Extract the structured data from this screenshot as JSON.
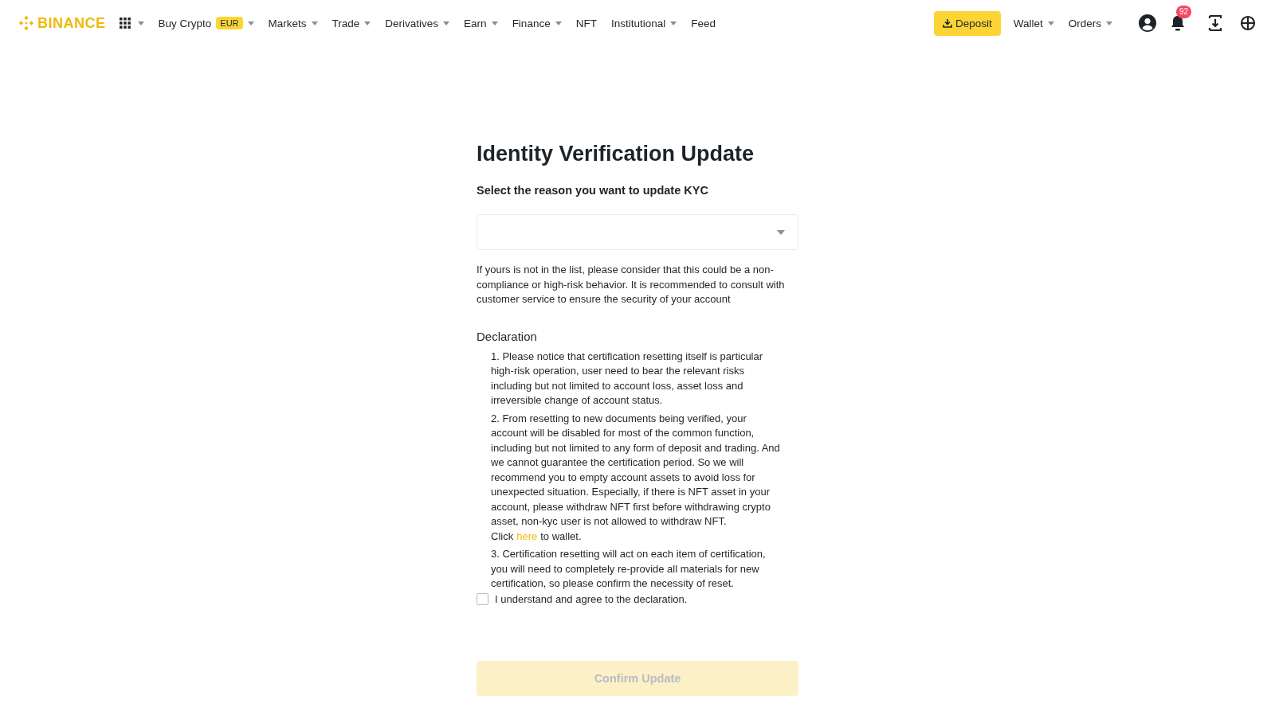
{
  "nav": {
    "logo": "BINANCE",
    "items": [
      {
        "label": "Buy Crypto",
        "badge": "EUR",
        "dropdown": true
      },
      {
        "label": "Markets",
        "dropdown": true
      },
      {
        "label": "Trade",
        "dropdown": true
      },
      {
        "label": "Derivatives",
        "dropdown": true
      },
      {
        "label": "Earn",
        "dropdown": true
      },
      {
        "label": "Finance",
        "dropdown": true
      },
      {
        "label": "NFT",
        "dropdown": false
      },
      {
        "label": "Institutional",
        "dropdown": true
      },
      {
        "label": "Feed",
        "dropdown": false
      }
    ],
    "deposit": "Deposit",
    "right_items": [
      {
        "label": "Wallet",
        "dropdown": true
      },
      {
        "label": "Orders",
        "dropdown": true
      }
    ],
    "notification_count": "92"
  },
  "page": {
    "title": "Identity Verification Update",
    "subtitle": "Select the reason you want to update KYC",
    "notice": "If yours is not in the list, please consider that this could be a non-compliance or high-risk behavior. It is recommended to consult with customer service to ensure the security of your account",
    "declaration_title": "Declaration",
    "declarations": [
      {
        "text": "1. Please notice that certification resetting itself is particular high-risk operation, user need to bear the relevant risks including but not limited to account loss, asset loss and irreversible change of account status."
      },
      {
        "text": "2. From resetting to new documents being verified, your account will be disabled for most of the common function, including but not limited to any form of deposit and trading. And we cannot guarantee the certification period. So we will recommend you to empty account assets to avoid loss for unexpected situation. Especially, if there is NFT asset in your account, please withdraw NFT first before withdrawing crypto asset, non-kyc user is not allowed to withdraw NFT. Click",
        "link": "here",
        "after": "to wallet."
      },
      {
        "text": "3. Certification resetting will act on each item of certification, you will need to completely re-provide all materials for new certification, so please confirm the necessity of reset."
      }
    ],
    "agree": {
      "label": "I understand and agree to the declaration.",
      "checked": false
    },
    "confirm": {
      "label": "Confirm Update",
      "disabled": true
    }
  }
}
